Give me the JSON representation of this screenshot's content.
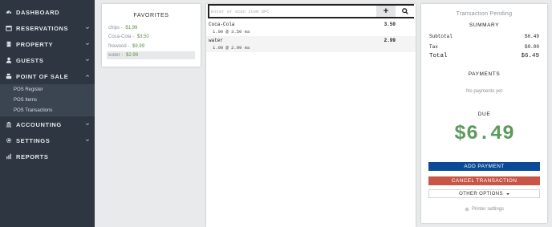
{
  "sidebar": {
    "items": [
      {
        "label": "DASHBOARD",
        "icon": "dashboard-icon"
      },
      {
        "label": "RESERVATIONS",
        "icon": "calendar-icon"
      },
      {
        "label": "PROPERTY",
        "icon": "building-icon"
      },
      {
        "label": "GUESTS",
        "icon": "user-icon"
      },
      {
        "label": "POINT OF SALE",
        "icon": "cash-register-icon"
      },
      {
        "label": "ACCOUNTING",
        "icon": "bank-icon"
      },
      {
        "label": "SETTINGS",
        "icon": "gear-icon"
      },
      {
        "label": "REPORTS",
        "icon": "bar-chart-icon"
      }
    ],
    "sub_items": [
      {
        "label": "POS Register"
      },
      {
        "label": "POS Items"
      },
      {
        "label": "POS Transactions"
      }
    ]
  },
  "favorites": {
    "title": "FAVORITES",
    "items": [
      {
        "name": "chips",
        "separator": " - ",
        "price": "$1.99"
      },
      {
        "name": "Coca-Cola",
        "separator": " - ",
        "price": "$3.50"
      },
      {
        "name": "firewood",
        "separator": " - ",
        "price": "$9.99"
      },
      {
        "name": "water",
        "separator": " - ",
        "price": "$2.99"
      }
    ]
  },
  "search": {
    "placeholder": "Enter or scan item UPC",
    "add_label": "+"
  },
  "lines": [
    {
      "name": "Coca-Cola",
      "qty": "1.00 @ 3.50 ea",
      "price": "3.50"
    },
    {
      "name": "water",
      "qty": "1.00 @ 2.99 ea",
      "price": "2.99"
    }
  ],
  "summary": {
    "status": "Transaction Pending",
    "summary_title": "SUMMARY",
    "subtotal_label": "Subtotal",
    "subtotal_value": "$6.49",
    "tax_label": "Tax",
    "tax_value": "$0.00",
    "total_label": "Total",
    "total_value": "$6.49",
    "payments_title": "PAYMENTS",
    "no_payments": "No payments yet",
    "due_title": "DUE",
    "due_amount": "$6.49",
    "add_payment": "ADD PAYMENT",
    "cancel_transaction": "CANCEL TRANSACTION",
    "other_options": "OTHER OPTIONS",
    "printer_settings": "Printer settings"
  },
  "colors": {
    "sidebar_bg": "#2d3641",
    "primary_button": "#0c4a97",
    "danger_button": "#c95547",
    "due_green": "#5e9a5e",
    "price_green": "#5c8f45"
  }
}
